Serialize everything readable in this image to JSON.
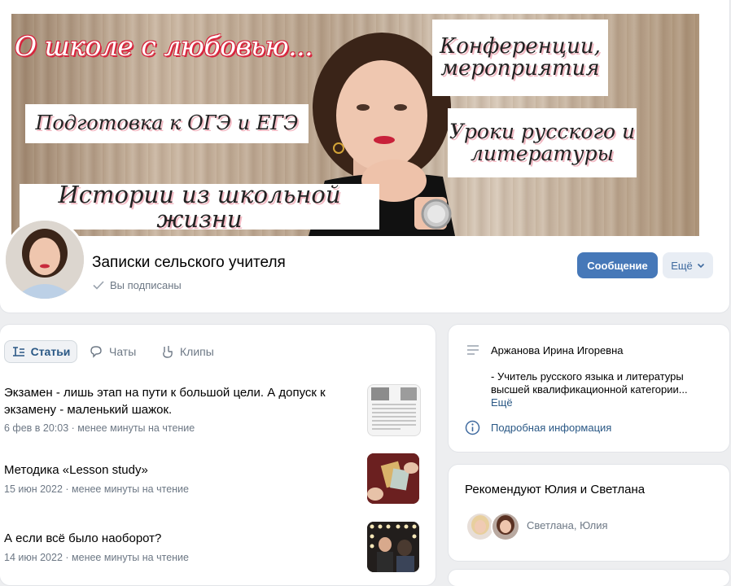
{
  "cover": {
    "title": "О школе с любовью...",
    "labels": {
      "exam_prep": "Подготовка к ОГЭ и ЕГЭ",
      "conferences": "Конференции, мероприятия",
      "lessons": "Уроки русского и литературы",
      "stories": "Истории из школьной жизни"
    }
  },
  "group": {
    "name": "Записки сельского учителя",
    "subscribed_label": "Вы подписаны",
    "message_button": "Сообщение",
    "more_button": "Ещё"
  },
  "tabs": [
    {
      "label": "Статьи",
      "icon": "articles-icon"
    },
    {
      "label": "Чаты",
      "icon": "chats-icon"
    },
    {
      "label": "Клипы",
      "icon": "clips-icon"
    }
  ],
  "posts": [
    {
      "title": "Экзамен - лишь этап на пути к большой цели. А допуск к экзамену - маленький шажок.",
      "meta": "6 фев в 20:03 · менее минуты на чтение"
    },
    {
      "title": "Методика «Lesson study»",
      "meta": "15 июн 2022 · менее минуты на чтение"
    },
    {
      "title": "А если всё было наоборот?",
      "meta": "14 июн 2022 · менее минуты на чтение"
    }
  ],
  "info": {
    "name": "Аржанова Ирина Игоревна",
    "description": "- Учитель русского языка и литературы высшей квалификационной категории...",
    "more": "Ещё",
    "details_link": "Подробная информация"
  },
  "recommend": {
    "title": "Рекомендуют Юлия и Светлана",
    "names": "Светлана, Юлия"
  },
  "colors": {
    "primary_button": "#4678b8",
    "link": "#2a5885",
    "muted": "#6d7885",
    "cover_accent": "#d8243d"
  }
}
